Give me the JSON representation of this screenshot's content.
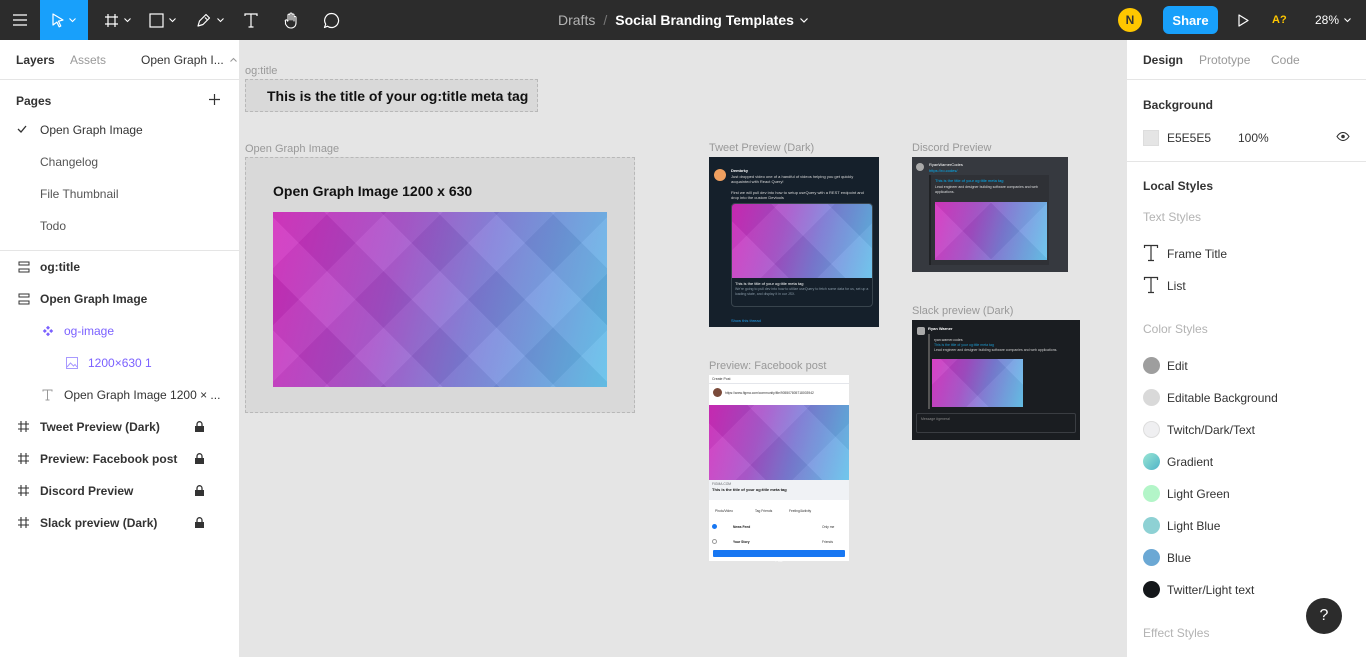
{
  "toolbar": {
    "breadcrumb_folder": "Drafts",
    "breadcrumb_sep": "/",
    "file_name": "Social Branding Templates",
    "avatar_initial": "N",
    "share_label": "Share",
    "font_warning": "A?",
    "zoom": "28%"
  },
  "left_panel": {
    "tabs": [
      "Layers",
      "Assets",
      "Open Graph I..."
    ],
    "pages_header": "Pages",
    "pages": [
      "Open Graph Image",
      "Changelog",
      "File Thumbnail",
      "Todo"
    ],
    "layers": [
      {
        "name": "og:title",
        "icon": "frame-grid-icon"
      },
      {
        "name": "Open Graph Image",
        "icon": "frame-grid-icon"
      },
      {
        "name": "og-image",
        "icon": "component-icon"
      },
      {
        "name": "1200×630 1",
        "icon": "image-icon"
      },
      {
        "name": "Open Graph Image 1200 × ...",
        "icon": "text-icon"
      },
      {
        "name": "Tweet Preview (Dark)",
        "icon": "frame-hash-icon"
      },
      {
        "name": "Preview: Facebook post",
        "icon": "frame-hash-icon"
      },
      {
        "name": "Discord Preview",
        "icon": "frame-hash-icon"
      },
      {
        "name": "Slack preview (Dark)",
        "icon": "frame-hash-icon"
      }
    ]
  },
  "canvas": {
    "og_title_label": "og:title",
    "og_title_text": "This is the title of your og:title meta tag",
    "og_image_label": "Open Graph Image",
    "og_image_heading": "Open Graph Image 1200 x 630",
    "tweet_label": "Tweet Preview (Dark)",
    "tweet_user": "Dembrky",
    "tweet_text1": "Just dropped video one of a handful of videos helping you get quickly acquainted with React Query!",
    "tweet_text2": "First we will pull dev into how to setup useQuery with a REST endpoint and drop into the custom Devtools",
    "tweet_card_title": "This is the title of your og:title meta tag",
    "tweet_card_desc": "We're going to pull dev into how to utilize useQuery to fetch some data for us, set up a loading state, and display it in our JSX.",
    "tweet_show": "Show this thread",
    "discord_label": "Discord Preview",
    "discord_user": "RyanWarnerCodes",
    "discord_link": "https://ro.codes/",
    "discord_title": "This is the title of your og:title meta tag",
    "discord_desc": "Lead engineer and designer building software companies and web applications.",
    "slack_label": "Slack preview (Dark)",
    "slack_user": "Ryan Warner",
    "slack_site": "ryan.warner.codes",
    "slack_title": "This is the title of your og:title meta tag",
    "slack_desc": "Lead engineer and designer building software companies and web applications.",
    "slack_input": "Message #general",
    "fb_label": "Preview: Facebook post",
    "fb_header": "Create Post",
    "fb_url": "https://www.figma.com/community/file/905507805718003942",
    "fb_domain": "FIGMA.COM",
    "fb_title": "This is the title of your og:title meta tag",
    "fb_actions": [
      "Photo/Video",
      "Tag Friends",
      "Feeling/Activity"
    ],
    "fb_newsfeed": "News Feed",
    "fb_story": "Your Story",
    "fb_only_me": "Only me",
    "fb_friends": "Friends",
    "fb_post": "Post"
  },
  "right_panel": {
    "tabs": [
      "Design",
      "Prototype",
      "Code"
    ],
    "background_header": "Background",
    "background_hex": "E5E5E5",
    "background_opacity": "100%",
    "local_styles_header": "Local Styles",
    "text_styles_header": "Text Styles",
    "text_styles": [
      "Frame Title",
      "List"
    ],
    "color_styles_header": "Color Styles",
    "color_styles": [
      {
        "name": "Edit",
        "color": "#9e9e9e"
      },
      {
        "name": "Editable Background",
        "color": "#d9d9d9"
      },
      {
        "name": "Twitch/Dark/Text",
        "color": "#efeff1"
      },
      {
        "name": "Gradient",
        "color": "#5ec0c0"
      },
      {
        "name": "Light Green",
        "color": "#b3f5c8"
      },
      {
        "name": "Light Blue",
        "color": "#8ed1d4"
      },
      {
        "name": "Blue",
        "color": "#6ba8d4"
      },
      {
        "name": "Twitter/Light text",
        "color": "#14171a"
      }
    ],
    "effect_styles_header": "Effect Styles"
  },
  "help_label": "?"
}
